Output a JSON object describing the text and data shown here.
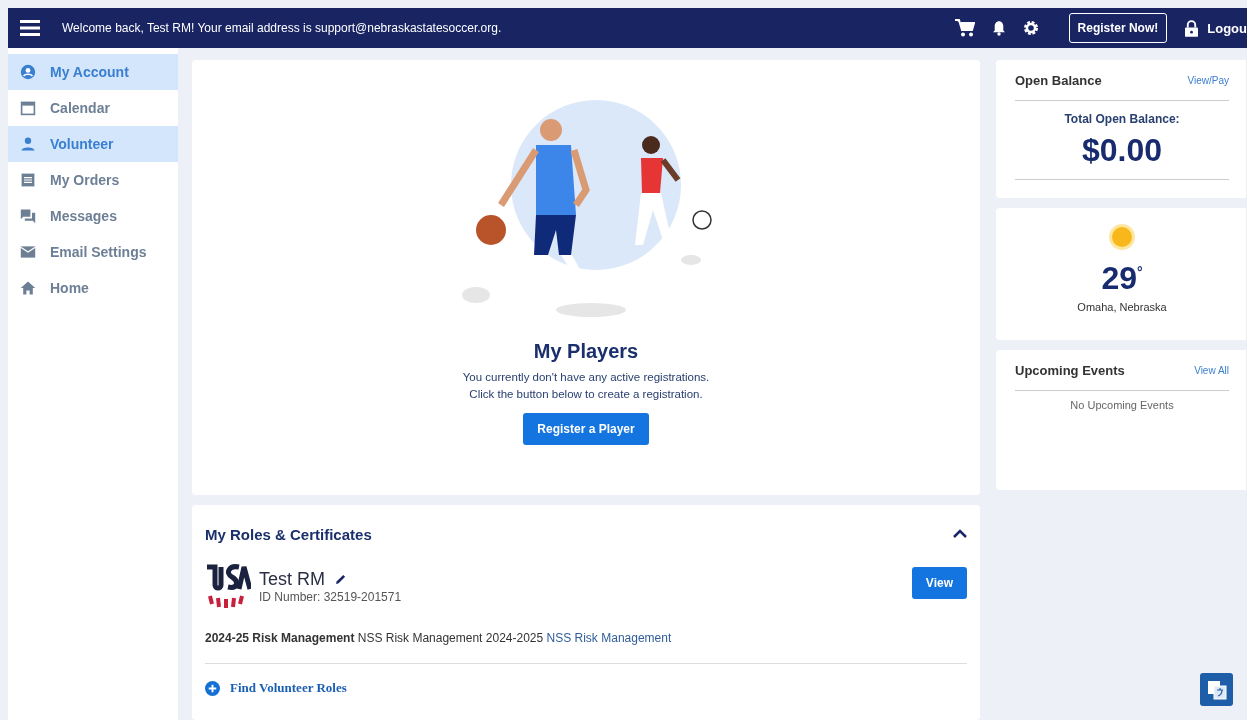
{
  "topbar": {
    "welcome": "Welcome back, Test RM! Your email address is support@nebraskastatesoccer.org.",
    "register_button": "Register Now!",
    "logout": "Logou"
  },
  "sidebar": {
    "items": [
      {
        "label": "My Account",
        "selected": true
      },
      {
        "label": "Calendar",
        "selected": false
      },
      {
        "label": "Volunteer",
        "selected": true
      },
      {
        "label": "My Orders",
        "selected": false
      },
      {
        "label": "Messages",
        "selected": false
      },
      {
        "label": "Email Settings",
        "selected": false
      },
      {
        "label": "Home",
        "selected": false
      }
    ]
  },
  "players": {
    "title": "My Players",
    "lines": [
      "You currently don't have any active registrations.",
      "Click the button below to create a registration."
    ],
    "button": "Register a Player"
  },
  "roles": {
    "title": "My Roles & Certificates",
    "expanded": true,
    "name": "Test RM",
    "id_number": "ID Number: 32519-201571",
    "view_button": "View",
    "certificate": "**2024-25 Risk Management** NSS Risk Management 2024-2025",
    "certificate_link": "NSS Risk Management",
    "find_link": "Find Volunteer Roles"
  },
  "balance": {
    "title": "Open Balance",
    "link": "View/Pay",
    "label": "Total Open Balance:",
    "amount": "$0.00"
  },
  "weather": {
    "temperature": "29",
    "unit": "°",
    "location": "Omaha, Nebraska"
  },
  "events": {
    "title": "Upcoming Events",
    "link": "View All",
    "empty": "No Upcoming Events"
  }
}
